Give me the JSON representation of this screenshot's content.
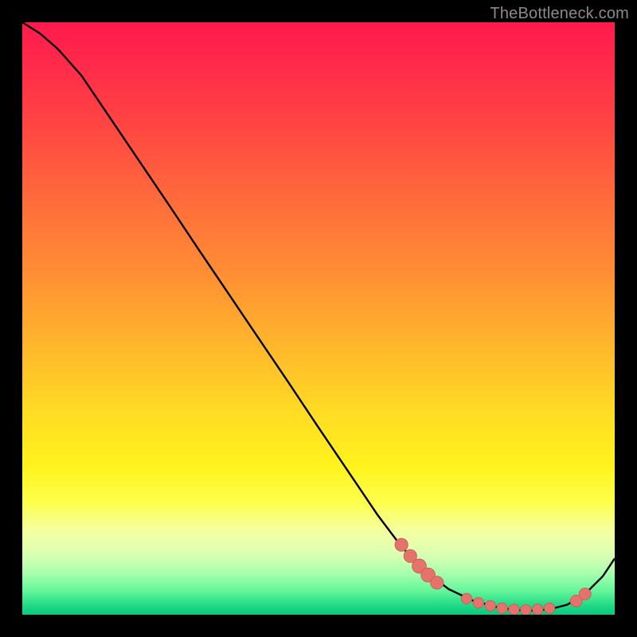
{
  "watermark": "TheBottleneck.com",
  "colors": {
    "curve": "#000000",
    "dot_fill": "#e4736c",
    "dot_stroke": "#c95a54",
    "gradient_top": "#ff1a4d",
    "gradient_bottom": "#08c97e"
  },
  "chart_data": {
    "type": "line",
    "title": "",
    "xlabel": "",
    "ylabel": "",
    "xlim": [
      0,
      100
    ],
    "ylim": [
      0,
      100
    ],
    "grid": false,
    "legend": false,
    "series": [
      {
        "name": "curve",
        "x": [
          0,
          3,
          6,
          10,
          15,
          20,
          25,
          30,
          35,
          40,
          45,
          50,
          55,
          60,
          64,
          68,
          72,
          76,
          80,
          83,
          86,
          89,
          92,
          95,
          98,
          100
        ],
        "y": [
          100,
          98.1,
          95.5,
          91,
          83.6,
          76.2,
          68.8,
          61.3,
          53.9,
          46.5,
          39.1,
          31.6,
          24.2,
          16.8,
          11.5,
          7.3,
          4.3,
          2.4,
          1.3,
          0.8,
          0.7,
          0.9,
          1.7,
          3.5,
          6.5,
          9.5
        ]
      }
    ],
    "dot_clusters": [
      {
        "name": "descent-cluster",
        "points": [
          {
            "x": 64.0,
            "y": 11.8,
            "r": 1.1
          },
          {
            "x": 65.5,
            "y": 9.9,
            "r": 1.1
          },
          {
            "x": 67.0,
            "y": 8.2,
            "r": 1.2
          },
          {
            "x": 68.5,
            "y": 6.7,
            "r": 1.2
          },
          {
            "x": 70.0,
            "y": 5.4,
            "r": 1.1
          }
        ]
      },
      {
        "name": "valley-cluster",
        "points": [
          {
            "x": 75.0,
            "y": 2.7,
            "r": 0.9
          },
          {
            "x": 77.0,
            "y": 2.0,
            "r": 0.9
          },
          {
            "x": 79.0,
            "y": 1.5,
            "r": 0.9
          },
          {
            "x": 81.0,
            "y": 1.1,
            "r": 0.9
          },
          {
            "x": 83.0,
            "y": 0.9,
            "r": 0.9
          },
          {
            "x": 85.0,
            "y": 0.8,
            "r": 0.9
          },
          {
            "x": 87.0,
            "y": 0.9,
            "r": 0.9
          },
          {
            "x": 89.0,
            "y": 1.1,
            "r": 0.9
          }
        ]
      },
      {
        "name": "ascent-cluster",
        "points": [
          {
            "x": 93.5,
            "y": 2.3,
            "r": 1.0
          },
          {
            "x": 95.0,
            "y": 3.5,
            "r": 1.0
          }
        ]
      }
    ]
  }
}
